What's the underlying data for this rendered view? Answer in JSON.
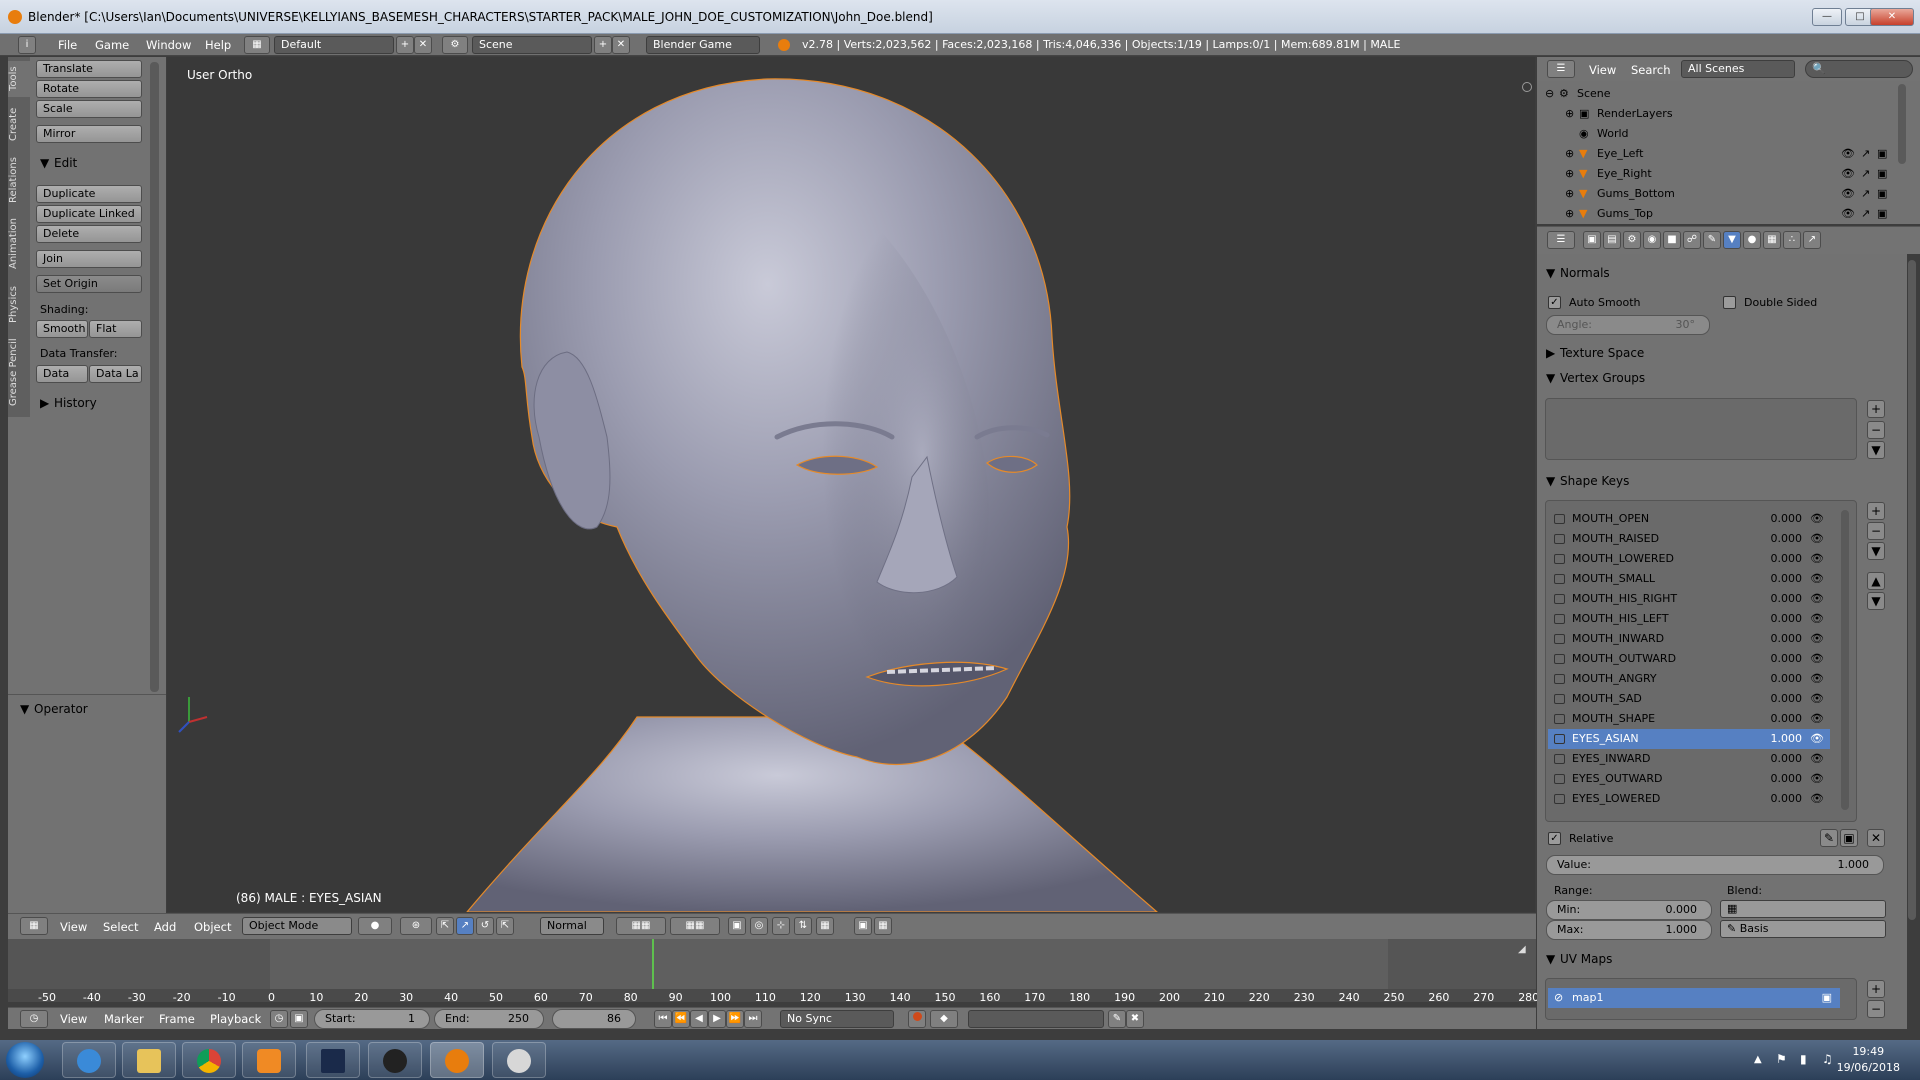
{
  "window": {
    "title": "Blender* [C:\\Users\\Ian\\Documents\\UNIVERSE\\KELLYIANS_BASEMESH_CHARACTERS\\STARTER_PACK\\MALE_JOHN_DOE_CUSTOMIZATION\\John_Doe.blend]"
  },
  "info_header": {
    "menus": [
      "File",
      "Game",
      "Window",
      "Help"
    ],
    "layout": "Default",
    "scene": "Scene",
    "engine": "Blender Game",
    "stats": "v2.78 | Verts:2,023,562 | Faces:2,023,168 | Tris:4,046,336 | Objects:1/19 | Lamps:0/1 | Mem:689.81M | MALE"
  },
  "tool_tabs": [
    "Tools",
    "Create",
    "Relations",
    "Animation",
    "Physics",
    "Grease Pencil"
  ],
  "tools": {
    "translate": "Translate",
    "rotate": "Rotate",
    "scale": "Scale",
    "mirror": "Mirror",
    "edit_header": "Edit",
    "duplicate": "Duplicate",
    "duplicate_linked": "Duplicate Linked",
    "delete": "Delete",
    "join": "Join",
    "set_origin": "Set Origin",
    "shading_label": "Shading:",
    "smooth": "Smooth",
    "flat": "Flat",
    "data_transfer_label": "Data Transfer:",
    "data": "Data",
    "data_la": "Data La",
    "history": "History",
    "operator": "Operator"
  },
  "viewport": {
    "view_name": "User Ortho",
    "object_info": "(86) MALE : EYES_ASIAN"
  },
  "viewport_header": {
    "menus": [
      "View",
      "Select",
      "Add",
      "Object"
    ],
    "mode": "Object Mode",
    "orientation": "Normal"
  },
  "timeline": {
    "ticks": [
      "-50",
      "-40",
      "-30",
      "-20",
      "-10",
      "0",
      "10",
      "20",
      "30",
      "40",
      "50",
      "60",
      "70",
      "80",
      "90",
      "100",
      "110",
      "120",
      "130",
      "140",
      "150",
      "160",
      "170",
      "180",
      "190",
      "200",
      "210",
      "220",
      "230",
      "240",
      "250",
      "260",
      "270",
      "280"
    ],
    "menus": [
      "View",
      "Marker",
      "Frame",
      "Playback"
    ],
    "start_label": "Start:",
    "start": "1",
    "end_label": "End:",
    "end": "250",
    "current": "86",
    "sync": "No Sync"
  },
  "outliner": {
    "menus": [
      "View",
      "Search"
    ],
    "scenes_dropdown": "All Scenes",
    "items": [
      {
        "label": "Scene"
      },
      {
        "label": "RenderLayers"
      },
      {
        "label": "World"
      },
      {
        "label": "Eye_Left"
      },
      {
        "label": "Eye_Right"
      },
      {
        "label": "Gums_Bottom"
      },
      {
        "label": "Gums_Top"
      }
    ]
  },
  "properties": {
    "normals": {
      "header": "Normals",
      "auto_smooth": "Auto Smooth",
      "double_sided": "Double Sided",
      "angle_label": "Angle:",
      "angle_value": "30°"
    },
    "texture_space": "Texture Space",
    "vertex_groups": "Vertex Groups",
    "shape_keys": {
      "header": "Shape Keys",
      "keys": [
        {
          "name": "MOUTH_OPEN",
          "value": "0.000"
        },
        {
          "name": "MOUTH_RAISED",
          "value": "0.000"
        },
        {
          "name": "MOUTH_LOWERED",
          "value": "0.000"
        },
        {
          "name": "MOUTH_SMALL",
          "value": "0.000"
        },
        {
          "name": "MOUTH_HIS_RIGHT",
          "value": "0.000"
        },
        {
          "name": "MOUTH_HIS_LEFT",
          "value": "0.000"
        },
        {
          "name": "MOUTH_INWARD",
          "value": "0.000"
        },
        {
          "name": "MOUTH_OUTWARD",
          "value": "0.000"
        },
        {
          "name": "MOUTH_ANGRY",
          "value": "0.000"
        },
        {
          "name": "MOUTH_SAD",
          "value": "0.000"
        },
        {
          "name": "MOUTH_SHAPE",
          "value": "0.000"
        },
        {
          "name": "EYES_ASIAN",
          "value": "1.000"
        },
        {
          "name": "EYES_INWARD",
          "value": "0.000"
        },
        {
          "name": "EYES_OUTWARD",
          "value": "0.000"
        },
        {
          "name": "EYES_LOWERED",
          "value": "0.000"
        }
      ],
      "relative": "Relative",
      "value_label": "Value:",
      "value": "1.000",
      "range_label": "Range:",
      "blend_label": "Blend:",
      "min_label": "Min:",
      "min": "0.000",
      "max_label": "Max:",
      "max": "1.000",
      "basis": "Basis"
    },
    "uv_maps": {
      "header": "UV Maps",
      "map": "map1"
    }
  },
  "taskbar": {
    "time": "19:49",
    "date": "19/06/2018"
  },
  "colors": {
    "accent_blue": "#5680c2",
    "blender_orange": "#e87d0d",
    "playhead": "#5ec04e"
  }
}
